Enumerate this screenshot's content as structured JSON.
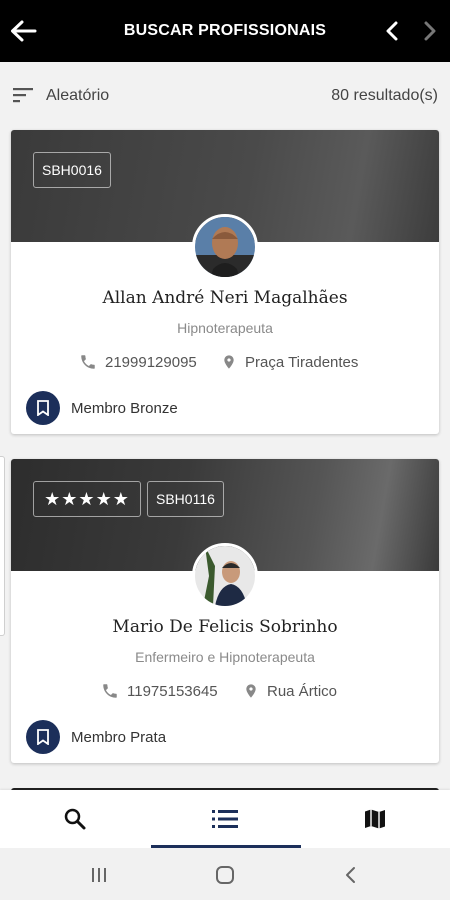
{
  "header": {
    "title": "BUSCAR PROFISSIONAIS",
    "back_icon": "arrow-left-icon",
    "prev_icon": "chevron-left-icon",
    "next_icon": "chevron-right-icon"
  },
  "sort": {
    "label": "Aleatório",
    "result_count": "80 resultado(s)",
    "icon": "sort-icon"
  },
  "cards": [
    {
      "code": "SBH0016",
      "name": "Allan André Neri Magalhães",
      "specialty": "Hipnoterapeuta",
      "phone": "21999129095",
      "location": "Praça Tiradentes",
      "membership": "Membro Bronze"
    },
    {
      "code": "SBH0116",
      "rating": "★★★★★",
      "name": "Mario De Felicis Sobrinho",
      "specialty": "Enfermeiro e Hipnoterapeuta",
      "phone": "11975153645",
      "location": "Rua Ártico",
      "membership": "Membro Prata"
    }
  ],
  "bottom_nav": [
    {
      "name": "search",
      "icon": "search-icon"
    },
    {
      "name": "list",
      "icon": "list-icon",
      "active": true
    },
    {
      "name": "map",
      "icon": "map-icon"
    }
  ],
  "colors": {
    "accent": "#1c2f5a",
    "topbar": "#000000"
  }
}
